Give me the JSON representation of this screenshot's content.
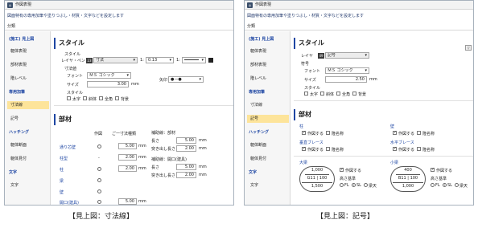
{
  "left": {
    "title": "作図表現",
    "desc": "図面特有の専用加筆や塗りつぶし・材質・文字などを設定します",
    "bunrui": "分類",
    "nav": [
      "(施工) 見上図",
      "躯体表現",
      "部材表現",
      "階レベル",
      "専用加筆",
      "寸法線",
      "記号",
      "ハッチング",
      "躯体断面",
      "躯体見付",
      "文字",
      "文字"
    ],
    "style": {
      "title": "スタイル",
      "label": "スタイル",
      "layer_label": "レイヤ・ペン",
      "layer_no": "23",
      "layer_name": "寸法",
      "pen_no1": "1:",
      "pen_val1": "0.13",
      "pen_no2": "1:",
      "sunpo_label": "寸法値",
      "font_label": "フォント",
      "font_val": "ＭＳ ゴシック",
      "size_label": "サイズ",
      "size_val": "3.00",
      "size_unit": "mm",
      "yajirushi": "矢印",
      "style2": "スタイル",
      "opts": [
        "太字",
        "斜体",
        "全角",
        "背景"
      ]
    },
    "buzai": {
      "title": "部材",
      "col1": "作図",
      "col2": "ご一寸法種類",
      "rows": [
        "通り芯壁",
        "柱型",
        "柱",
        "梁",
        "壁",
        "開口(建具)"
      ],
      "v1": "5.00",
      "v2": "2.00",
      "v3": "2.00",
      "v4": "5.00",
      "unit": "mm",
      "hosoku": "補助線：部材",
      "r1": "長さ",
      "r1v": "5.00",
      "r2": "突き出し長さ",
      "r2v": "2.00",
      "hosoku2": "補助線：開口(建具)",
      "r3": "長さ",
      "r3v": "5.00",
      "r4": "突き出し長さ",
      "r4v": "2.00"
    }
  },
  "right": {
    "title": "作図表現",
    "desc": "図面特有の専用加筆や塗りつぶし・材質・文字などを設定します",
    "bunrui": "分類",
    "nav": [
      "(施工) 見上図",
      "躯体表現",
      "部材表現",
      "階レベル",
      "専用加筆",
      "寸法線",
      "記号",
      "ハッチング",
      "躯体断面",
      "躯体見付",
      "文字",
      "文字"
    ],
    "style": {
      "title": "スタイル",
      "layer_label": "レイヤ",
      "layer_no": "49",
      "layer_name": "記号",
      "fugo": "符号",
      "font_label": "フォント",
      "font_val": "ＭＳ ゴシック",
      "size_label": "サイズ",
      "size_val": "2.50",
      "size_unit": "mm",
      "style2": "スタイル",
      "opts": [
        "太字",
        "斜体",
        "全角",
        "背景"
      ]
    },
    "buzai": {
      "title": "部材",
      "hashira": "柱",
      "kabe": "壁",
      "suichoku": "垂直ブレース",
      "suihei": "水平ブレース",
      "sakuzu": "作図する",
      "ryakusho": "隆名称",
      "ooari": "大梁",
      "koari": "小梁",
      "takasa": "高さ基準",
      "fl": "FL",
      "sl": "SL",
      "kiso": "梁天",
      "d1": "1,000",
      "d2": "G11",
      "d3": "100",
      "d4": "1,500",
      "e1": "400",
      "e2": "B11",
      "e3": "100",
      "e4": "1,000"
    }
  },
  "captions": {
    "left": "【見上図：寸法線】",
    "right": "【見上図：記号】"
  }
}
